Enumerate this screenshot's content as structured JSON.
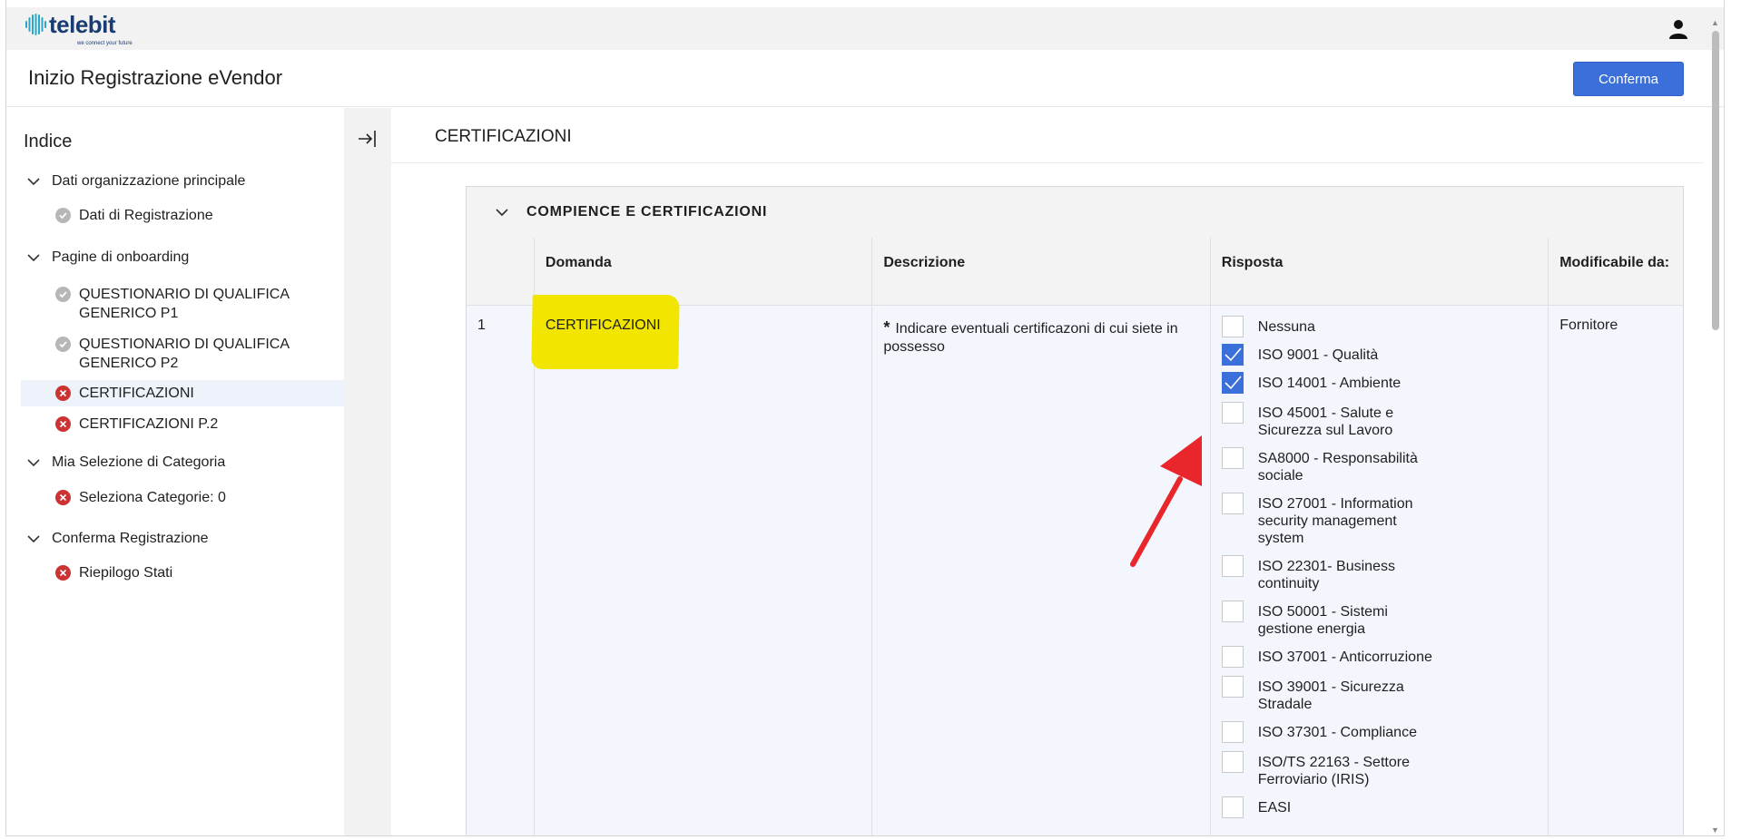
{
  "brand": {
    "name": "telebit",
    "tagline": "we connect your future",
    "color": "#1b3c73"
  },
  "header": {
    "title": "Inizio Registrazione eVendor",
    "confirm_label": "Conferma",
    "accent": "#3b6fd9"
  },
  "sidebar": {
    "heading": "Indice",
    "groups": [
      {
        "label": "Dati organizzazione principale",
        "items": [
          {
            "label": "Dati di Registrazione",
            "status": "done"
          }
        ]
      },
      {
        "label": "Pagine di onboarding",
        "items": [
          {
            "label": "QUESTIONARIO DI QUALIFICA GENERICO P1",
            "status": "done"
          },
          {
            "label": "QUESTIONARIO DI QUALIFICA GENERICO P2",
            "status": "done"
          },
          {
            "label": "CERTIFICAZIONI",
            "status": "error"
          },
          {
            "label": "CERTIFICAZIONI P.2",
            "status": "error"
          }
        ]
      },
      {
        "label": "Mia Selezione di Categoria",
        "items": [
          {
            "label": "Seleziona Categorie: 0",
            "status": "error"
          }
        ]
      },
      {
        "label": "Conferma Registrazione",
        "items": [
          {
            "label": "Riepilogo Stati",
            "status": "error"
          }
        ]
      }
    ]
  },
  "main": {
    "title": "CERTIFICAZIONI",
    "section": {
      "title": "COMPIENCE E CERTIFICAZIONI",
      "columns": [
        "Domanda",
        "Descrizione",
        "Risposta",
        "Modificabile da:"
      ],
      "row": {
        "number": "1",
        "question": "CERTIFICAZIONI",
        "required_mark": "*",
        "description": "Indicare eventuali certificazoni di cui siete in possesso",
        "editable_by": "Fornitore",
        "options": [
          {
            "label": "Nessuna",
            "checked": false
          },
          {
            "label": "ISO 9001 - Qualità",
            "checked": true
          },
          {
            "label": "ISO 14001 - Ambiente",
            "checked": true
          },
          {
            "label": "ISO 45001 - Salute e Sicurezza sul Lavoro",
            "checked": false
          },
          {
            "label": "SA8000 - Responsabilità sociale",
            "checked": false
          },
          {
            "label": "ISO 27001 - Information security management system",
            "checked": false
          },
          {
            "label": "ISO 22301- Business continuity",
            "checked": false
          },
          {
            "label": "ISO 50001 - Sistemi gestione energia",
            "checked": false
          },
          {
            "label": "ISO 37001 - Anticorruzione",
            "checked": false
          },
          {
            "label": "ISO 39001 - Sicurezza Stradale",
            "checked": false
          },
          {
            "label": "ISO 37301 - Compliance",
            "checked": false
          },
          {
            "label": "ISO/TS 22163 - Settore Ferroviario (IRIS)",
            "checked": false
          },
          {
            "label": "EASI",
            "checked": false
          }
        ]
      }
    }
  }
}
